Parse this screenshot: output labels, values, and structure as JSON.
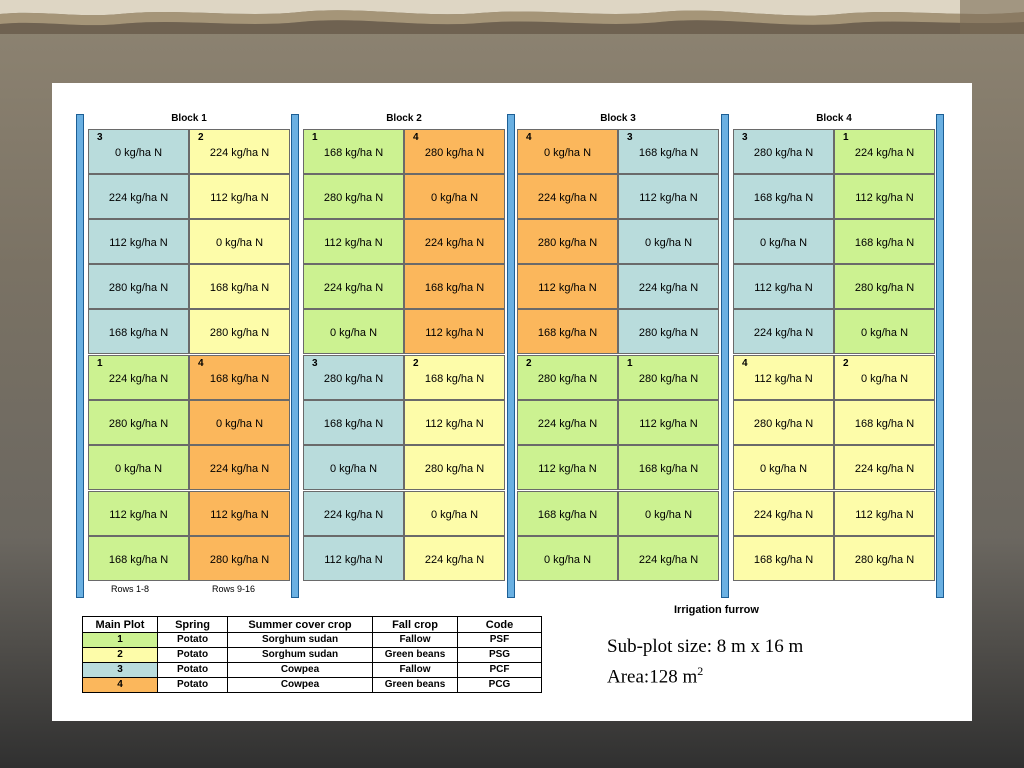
{
  "blocks": [
    {
      "title": "Block 1",
      "columns": [
        {
          "number_top": "3",
          "number_bottom": "1",
          "top_type": 3,
          "bottom_type": 1,
          "cells": [
            "0 kg/ha N",
            "224 kg/ha N",
            "112 kg/ha N",
            "280 kg/ha N",
            "168 kg/ha N",
            "224 kg/ha N",
            "280 kg/ha N",
            "0 kg/ha N",
            "112 kg/ha N",
            "168 kg/ha N"
          ]
        },
        {
          "number_top": "2",
          "number_bottom": "4",
          "top_type": 2,
          "bottom_type": 4,
          "cells": [
            "224 kg/ha N",
            "112 kg/ha N",
            "0 kg/ha N",
            "168 kg/ha N",
            "280 kg/ha N",
            "168 kg/ha N",
            "0 kg/ha N",
            "224 kg/ha N",
            "112 kg/ha N",
            "280 kg/ha N"
          ]
        }
      ]
    },
    {
      "title": "Block 2",
      "columns": [
        {
          "number_top": "1",
          "number_bottom": "3",
          "top_type": 1,
          "bottom_type": 3,
          "cells": [
            "168 kg/ha N",
            "280 kg/ha N",
            "112 kg/ha N",
            "224 kg/ha N",
            "0 kg/ha N",
            "280 kg/ha N",
            "168 kg/ha N",
            "0 kg/ha N",
            "224 kg/ha N",
            "112 kg/ha N"
          ]
        },
        {
          "number_top": "4",
          "number_bottom": "2",
          "top_type": 4,
          "bottom_type": 2,
          "cells": [
            "280 kg/ha N",
            "0 kg/ha N",
            "224 kg/ha N",
            "168 kg/ha N",
            "112 kg/ha N",
            "168 kg/ha N",
            "112 kg/ha N",
            "280 kg/ha N",
            "0 kg/ha N",
            "224 kg/ha N"
          ]
        }
      ]
    },
    {
      "title": "Block 3",
      "columns": [
        {
          "number_top": "4",
          "number_bottom": "2",
          "top_type": 4,
          "bottom_type": 1,
          "cells": [
            "0 kg/ha N",
            "224 kg/ha N",
            "280 kg/ha N",
            "112 kg/ha N",
            "168 kg/ha N",
            "280 kg/ha N",
            "224 kg/ha N",
            "112 kg/ha N",
            "168 kg/ha N",
            "0 kg/ha N"
          ]
        },
        {
          "number_top": "3",
          "number_bottom": "1",
          "top_type": 3,
          "bottom_type": 1,
          "cells": [
            "168 kg/ha N",
            "112 kg/ha N",
            "0 kg/ha N",
            "224 kg/ha N",
            "280 kg/ha N",
            "280 kg/ha N",
            "112 kg/ha N",
            "168 kg/ha N",
            "0 kg/ha N",
            "224 kg/ha N"
          ]
        }
      ]
    },
    {
      "title": "Block 4",
      "columns": [
        {
          "number_top": "3",
          "number_bottom": "4",
          "top_type": 3,
          "bottom_type": 2,
          "cells": [
            "280 kg/ha N",
            "168 kg/ha N",
            "0 kg/ha N",
            "112 kg/ha N",
            "224 kg/ha N",
            "112 kg/ha N",
            "280 kg/ha N",
            "0 kg/ha N",
            "224 kg/ha N",
            "168 kg/ha N"
          ]
        },
        {
          "number_top": "1",
          "number_bottom": "2",
          "top_type": 1,
          "bottom_type": 2,
          "cells": [
            "224 kg/ha N",
            "112 kg/ha N",
            "168 kg/ha N",
            "280 kg/ha N",
            "0 kg/ha N",
            "0 kg/ha N",
            "168 kg/ha N",
            "224 kg/ha N",
            "112 kg/ha N",
            "280 kg/ha N"
          ]
        }
      ]
    }
  ],
  "rows_label_1": "Rows 1-8",
  "rows_label_2": "Rows 9-16",
  "furrow_label": "Irrigation furrow",
  "legend": {
    "headers": [
      "Main Plot",
      "Spring",
      "Summer cover crop",
      "Fall crop",
      "Code"
    ],
    "rows": [
      [
        "1",
        "Potato",
        "Sorghum sudan",
        "Fallow",
        "PSF"
      ],
      [
        "2",
        "Potato",
        "Sorghum sudan",
        "Green beans",
        "PSG"
      ],
      [
        "3",
        "Potato",
        "Cowpea",
        "Fallow",
        "PCF"
      ],
      [
        "4",
        "Potato",
        "Cowpea",
        "Green beans",
        "PCG"
      ]
    ]
  },
  "info": {
    "size_text": "Sub-plot size: 8 m x 16 m",
    "area_text": "Area:128 m",
    "area_sup": "2"
  },
  "colors": {
    "plot_1": "#ccf291",
    "plot_2": "#fdfca9",
    "plot_3": "#b9dcdc",
    "plot_4": "#fbb75c",
    "furrow": "#6ab0e2"
  }
}
